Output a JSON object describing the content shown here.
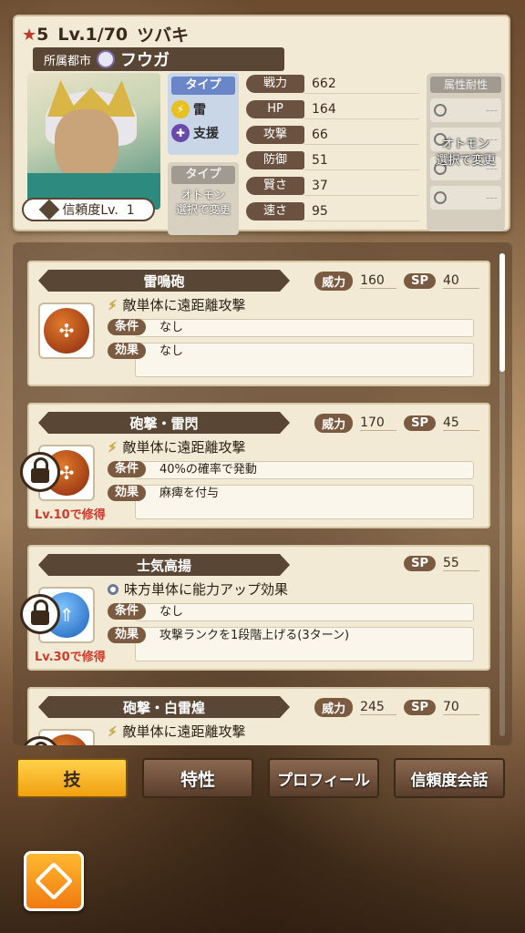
{
  "header": {
    "rarity": "5",
    "level": "Lv.1/70",
    "name": "ツバキ",
    "city_label": "所属都市",
    "city_name": "フウガ",
    "trust": "信頼度Lv.  1",
    "type_label": "タイプ",
    "type_1": "雷",
    "type_2": "支援",
    "otomon_label": "タイプ",
    "otomon_text_1": "オトモン",
    "otomon_text_2": "選択で変更"
  },
  "stats": [
    {
      "key": "戦力",
      "value": "662"
    },
    {
      "key": "HP",
      "value": "164"
    },
    {
      "key": "攻撃",
      "value": "66"
    },
    {
      "key": "防御",
      "value": "51"
    },
    {
      "key": "賢さ",
      "value": "37"
    },
    {
      "key": "速さ",
      "value": "95"
    }
  ],
  "resist": {
    "title": "属性耐性",
    "dash": "---",
    "overlay_1": "オトモン",
    "overlay_2": "選択で変更"
  },
  "skills": [
    {
      "name": "雷鳴砲",
      "power_label": "威力",
      "power": "160",
      "sp_label": "SP",
      "sp": "40",
      "desc": "敵単体に遠距離攻撃",
      "cond_label": "条件",
      "cond": "なし",
      "eff_label": "効果",
      "eff": "なし",
      "unlock": ""
    },
    {
      "name": "砲撃・雷閃",
      "power_label": "威力",
      "power": "170",
      "sp_label": "SP",
      "sp": "45",
      "desc": "敵単体に遠距離攻撃",
      "cond_label": "条件",
      "cond": "40%の確率で発動",
      "eff_label": "効果",
      "eff": "麻痺を付与",
      "unlock": "Lv.10で修得"
    },
    {
      "name": "士気高揚",
      "sp_label": "SP",
      "sp": "55",
      "desc": "味方単体に能力アップ効果",
      "cond_label": "条件",
      "cond": "なし",
      "eff_label": "効果",
      "eff": "攻撃ランクを1段階上げる(3ターン)",
      "unlock": "Lv.30で修得"
    },
    {
      "name": "砲撃・白雷煌",
      "power_label": "威力",
      "power": "245",
      "sp_label": "SP",
      "sp": "70",
      "desc": "敵単体に遠距離攻撃"
    }
  ],
  "tabs": [
    "技",
    "特性",
    "プロフィール",
    "信頼度会話"
  ],
  "colors": {
    "accent": "#f0a010",
    "panel": "#f3ead6",
    "dark": "#5a4634"
  }
}
